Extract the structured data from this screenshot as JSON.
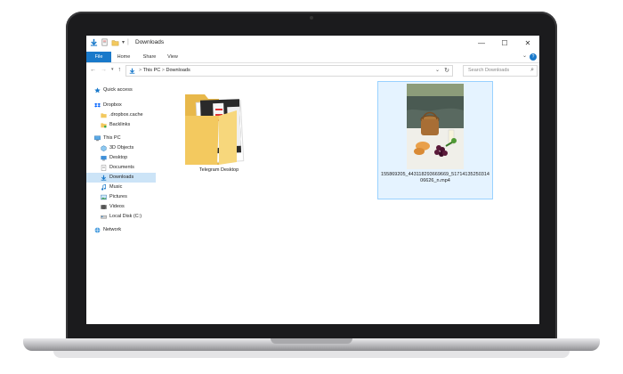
{
  "window": {
    "title": "Downloads",
    "controls": {
      "minimize": "—",
      "maximize": "☐",
      "close": "✕"
    }
  },
  "ribbon": {
    "tabs": [
      "File",
      "Home",
      "Share",
      "View"
    ]
  },
  "address": {
    "path": [
      "This PC",
      "Downloads"
    ],
    "separator": ">",
    "search_placeholder": "Search Downloads"
  },
  "sidebar": {
    "items": [
      {
        "label": "Quick access",
        "icon": "star-icon"
      },
      {
        "label": "Dropbox",
        "icon": "dropbox-icon"
      },
      {
        "label": ".dropbox.cache",
        "icon": "folder-icon"
      },
      {
        "label": "Backlinks",
        "icon": "folder-icon"
      },
      {
        "label": "This PC",
        "icon": "computer-icon"
      },
      {
        "label": "3D Objects",
        "icon": "cube-icon"
      },
      {
        "label": "Desktop",
        "icon": "desktop-icon"
      },
      {
        "label": "Documents",
        "icon": "document-icon"
      },
      {
        "label": "Downloads",
        "icon": "download-icon"
      },
      {
        "label": "Music",
        "icon": "music-icon"
      },
      {
        "label": "Pictures",
        "icon": "picture-icon"
      },
      {
        "label": "Videos",
        "icon": "video-icon"
      },
      {
        "label": "Local Disk (C:)",
        "icon": "drive-icon"
      },
      {
        "label": "Network",
        "icon": "network-icon"
      }
    ],
    "selected": "Downloads"
  },
  "files": [
    {
      "name": "Telegram Desktop",
      "type": "folder"
    },
    {
      "name": "155869205_443118293669669_5171413525031406626_n.mp4",
      "type": "video",
      "selected": true
    }
  ],
  "colors": {
    "accent": "#1979ca",
    "selection": "#cce4f7",
    "folder": "#f3c95f"
  }
}
